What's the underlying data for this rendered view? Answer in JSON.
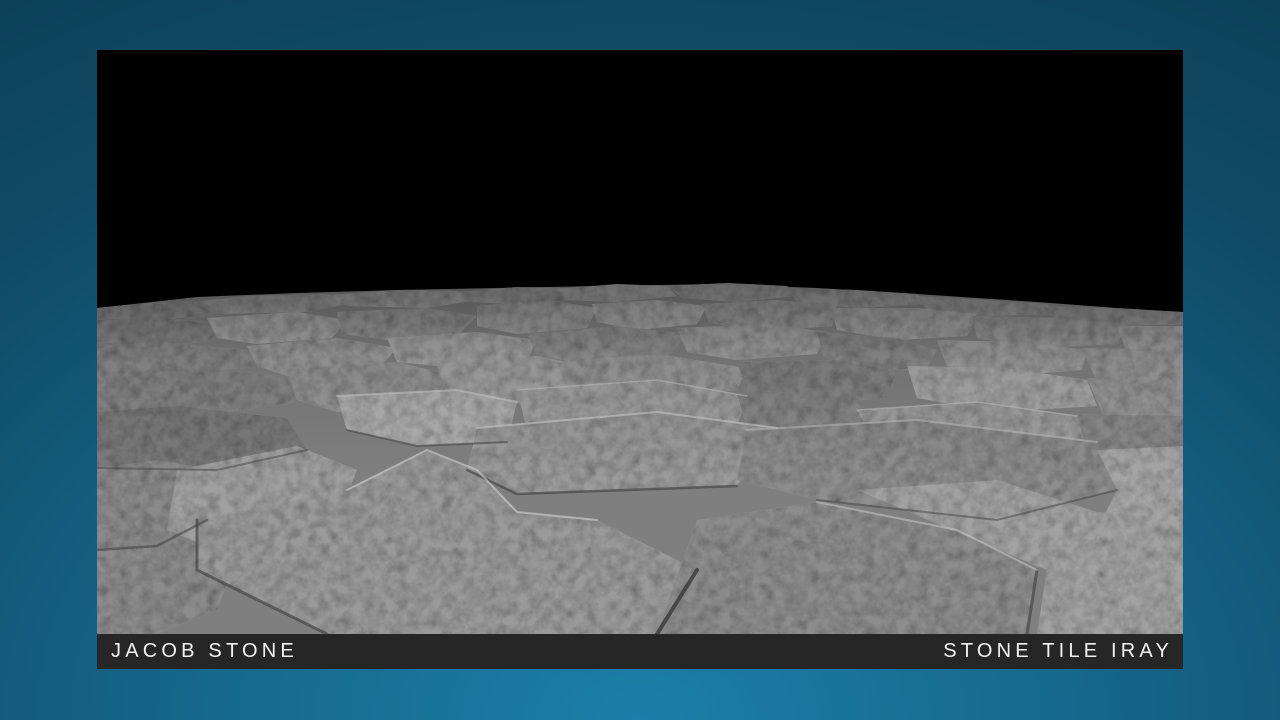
{
  "slide": {
    "artist_name": "JACOB STONE",
    "render_title": "STONE TILE IRAY"
  },
  "render": {
    "subject": "grey-stone-tile-field",
    "background": "black-void",
    "colors": {
      "sky": "#000000",
      "stone_light": "#b8b8b8",
      "stone_mid": "#8a8a8a",
      "stone_dark": "#4a4a4a"
    }
  },
  "colors": {
    "page_gradient_center": "#1c7fa8",
    "page_gradient_edge": "#0d4059",
    "caption_bar": "#262626",
    "caption_text": "#f2f2f2"
  }
}
